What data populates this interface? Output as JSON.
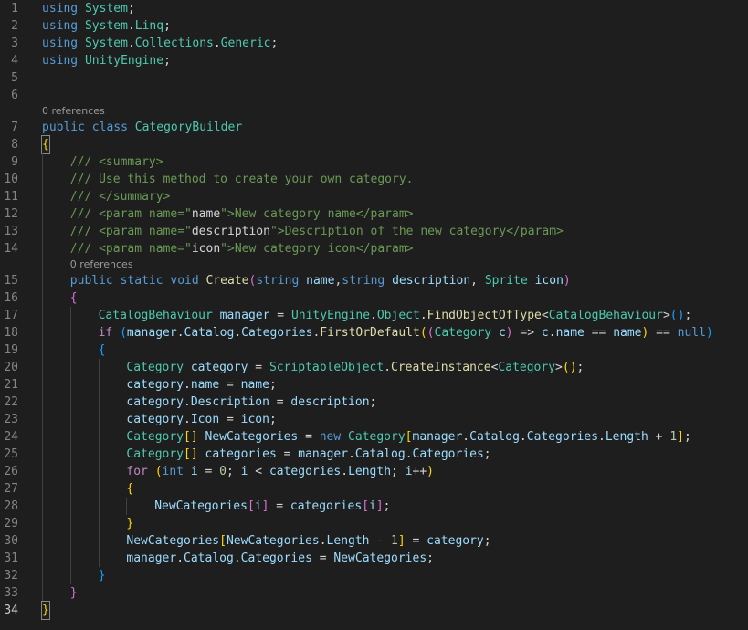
{
  "editor": {
    "theme_colors": {
      "background": "#1e1e1e",
      "keyword": "#569cd6",
      "control": "#c586c0",
      "type": "#4ec9b0",
      "function": "#dcdcaa",
      "identifier": "#9cdcfe",
      "comment": "#6a9955",
      "number": "#b5cea8",
      "bracket_level_1": "#ffd700",
      "bracket_level_2": "#da70d6",
      "bracket_level_3": "#179fff"
    },
    "active_line": 34,
    "lines": [
      {
        "kind": "line",
        "n": "1",
        "tokens": [
          {
            "t": "using",
            "c": "kw"
          },
          {
            "t": " "
          },
          {
            "t": "System",
            "c": "ty"
          },
          {
            "t": ";"
          }
        ]
      },
      {
        "kind": "line",
        "n": "2",
        "tokens": [
          {
            "t": "using",
            "c": "kw"
          },
          {
            "t": " "
          },
          {
            "t": "System",
            "c": "ty"
          },
          {
            "t": "."
          },
          {
            "t": "Linq",
            "c": "ty"
          },
          {
            "t": ";"
          }
        ]
      },
      {
        "kind": "line",
        "n": "3",
        "tokens": [
          {
            "t": "using",
            "c": "kw"
          },
          {
            "t": " "
          },
          {
            "t": "System",
            "c": "ty"
          },
          {
            "t": "."
          },
          {
            "t": "Collections",
            "c": "ty"
          },
          {
            "t": "."
          },
          {
            "t": "Generic",
            "c": "ty"
          },
          {
            "t": ";"
          }
        ]
      },
      {
        "kind": "line",
        "n": "4",
        "tokens": [
          {
            "t": "using",
            "c": "kw"
          },
          {
            "t": " "
          },
          {
            "t": "UnityEngine",
            "c": "ty"
          },
          {
            "t": ";"
          }
        ]
      },
      {
        "kind": "line",
        "n": "5",
        "tokens": []
      },
      {
        "kind": "line",
        "n": "6",
        "tokens": []
      },
      {
        "kind": "lens",
        "indent": 0,
        "text": "0 references"
      },
      {
        "kind": "line",
        "n": "7",
        "tokens": [
          {
            "t": "public",
            "c": "kw"
          },
          {
            "t": " "
          },
          {
            "t": "class",
            "c": "kw"
          },
          {
            "t": " "
          },
          {
            "t": "CategoryBuilder",
            "c": "ty"
          }
        ]
      },
      {
        "kind": "line",
        "n": "8",
        "tokens": [
          {
            "t": "{",
            "c": "b1",
            "cursor": true
          }
        ]
      },
      {
        "kind": "line",
        "n": "9",
        "indent": 1,
        "tokens": [
          {
            "t": "/// ",
            "c": "cm"
          },
          {
            "t": "<summary>",
            "c": "cm"
          }
        ]
      },
      {
        "kind": "line",
        "n": "10",
        "indent": 1,
        "tokens": [
          {
            "t": "/// Use this method to create your own category.",
            "c": "cm"
          }
        ]
      },
      {
        "kind": "line",
        "n": "11",
        "indent": 1,
        "tokens": [
          {
            "t": "/// ",
            "c": "cm"
          },
          {
            "t": "</summary>",
            "c": "cm"
          }
        ]
      },
      {
        "kind": "line",
        "n": "12",
        "indent": 1,
        "tokens": [
          {
            "t": "/// <param name=\"",
            "c": "cm"
          },
          {
            "t": "name",
            "c": "cx"
          },
          {
            "t": "\">New category name</param>",
            "c": "cm"
          }
        ]
      },
      {
        "kind": "line",
        "n": "13",
        "indent": 1,
        "tokens": [
          {
            "t": "/// <param name=\"",
            "c": "cm"
          },
          {
            "t": "description",
            "c": "cx"
          },
          {
            "t": "\">Description of the new category</param>",
            "c": "cm"
          }
        ]
      },
      {
        "kind": "line",
        "n": "14",
        "indent": 1,
        "tokens": [
          {
            "t": "/// <param name=\"",
            "c": "cm"
          },
          {
            "t": "icon",
            "c": "cx"
          },
          {
            "t": "\">New category icon</param>",
            "c": "cm"
          }
        ]
      },
      {
        "kind": "lens",
        "indent": 1,
        "text": "0 references"
      },
      {
        "kind": "line",
        "n": "15",
        "indent": 1,
        "tokens": [
          {
            "t": "public",
            "c": "kw"
          },
          {
            "t": " "
          },
          {
            "t": "static",
            "c": "kw"
          },
          {
            "t": " "
          },
          {
            "t": "void",
            "c": "kw"
          },
          {
            "t": " "
          },
          {
            "t": "Create",
            "c": "fn"
          },
          {
            "t": "(",
            "c": "b2"
          },
          {
            "t": "string",
            "c": "kw"
          },
          {
            "t": " "
          },
          {
            "t": "name",
            "c": "id"
          },
          {
            "t": ","
          },
          {
            "t": "string",
            "c": "kw"
          },
          {
            "t": " "
          },
          {
            "t": "description",
            "c": "id"
          },
          {
            "t": ", "
          },
          {
            "t": "Sprite",
            "c": "ty"
          },
          {
            "t": " "
          },
          {
            "t": "icon",
            "c": "id"
          },
          {
            "t": ")",
            "c": "b2"
          }
        ]
      },
      {
        "kind": "line",
        "n": "16",
        "indent": 1,
        "tokens": [
          {
            "t": "{",
            "c": "b2"
          }
        ]
      },
      {
        "kind": "line",
        "n": "17",
        "indent": 2,
        "tokens": [
          {
            "t": "CatalogBehaviour",
            "c": "ty"
          },
          {
            "t": " "
          },
          {
            "t": "manager",
            "c": "id"
          },
          {
            "t": " = "
          },
          {
            "t": "UnityEngine",
            "c": "ty"
          },
          {
            "t": "."
          },
          {
            "t": "Object",
            "c": "ty"
          },
          {
            "t": "."
          },
          {
            "t": "FindObjectOfType",
            "c": "fn"
          },
          {
            "t": "<"
          },
          {
            "t": "CatalogBehaviour",
            "c": "ty"
          },
          {
            "t": ">"
          },
          {
            "t": "()",
            "c": "b3"
          },
          {
            "t": ";"
          }
        ]
      },
      {
        "kind": "line",
        "n": "18",
        "indent": 2,
        "tokens": [
          {
            "t": "if",
            "c": "ctl"
          },
          {
            "t": " "
          },
          {
            "t": "(",
            "c": "b3"
          },
          {
            "t": "manager",
            "c": "id"
          },
          {
            "t": "."
          },
          {
            "t": "Catalog",
            "c": "id"
          },
          {
            "t": "."
          },
          {
            "t": "Categories",
            "c": "id"
          },
          {
            "t": "."
          },
          {
            "t": "FirstOrDefault",
            "c": "fn"
          },
          {
            "t": "(",
            "c": "b1"
          },
          {
            "t": "(",
            "c": "b2"
          },
          {
            "t": "Category",
            "c": "ty"
          },
          {
            "t": " "
          },
          {
            "t": "c",
            "c": "id"
          },
          {
            "t": ")",
            "c": "b2"
          },
          {
            "t": " => "
          },
          {
            "t": "c",
            "c": "id"
          },
          {
            "t": "."
          },
          {
            "t": "name",
            "c": "id"
          },
          {
            "t": " == "
          },
          {
            "t": "name",
            "c": "id"
          },
          {
            "t": ")",
            "c": "b1"
          },
          {
            "t": " == "
          },
          {
            "t": "null",
            "c": "kw"
          },
          {
            "t": ")",
            "c": "b3"
          }
        ]
      },
      {
        "kind": "line",
        "n": "19",
        "indent": 2,
        "tokens": [
          {
            "t": "{",
            "c": "b3"
          }
        ]
      },
      {
        "kind": "line",
        "n": "20",
        "indent": 3,
        "tokens": [
          {
            "t": "Category",
            "c": "ty"
          },
          {
            "t": " "
          },
          {
            "t": "category",
            "c": "id"
          },
          {
            "t": " = "
          },
          {
            "t": "ScriptableObject",
            "c": "ty"
          },
          {
            "t": "."
          },
          {
            "t": "CreateInstance",
            "c": "fn"
          },
          {
            "t": "<"
          },
          {
            "t": "Category",
            "c": "ty"
          },
          {
            "t": ">"
          },
          {
            "t": "()",
            "c": "b1"
          },
          {
            "t": ";"
          }
        ]
      },
      {
        "kind": "line",
        "n": "21",
        "indent": 3,
        "tokens": [
          {
            "t": "category",
            "c": "id"
          },
          {
            "t": "."
          },
          {
            "t": "name",
            "c": "id"
          },
          {
            "t": " = "
          },
          {
            "t": "name",
            "c": "id"
          },
          {
            "t": ";"
          }
        ]
      },
      {
        "kind": "line",
        "n": "22",
        "indent": 3,
        "tokens": [
          {
            "t": "category",
            "c": "id"
          },
          {
            "t": "."
          },
          {
            "t": "Description",
            "c": "id"
          },
          {
            "t": " = "
          },
          {
            "t": "description",
            "c": "id"
          },
          {
            "t": ";"
          }
        ]
      },
      {
        "kind": "line",
        "n": "23",
        "indent": 3,
        "tokens": [
          {
            "t": "category",
            "c": "id"
          },
          {
            "t": "."
          },
          {
            "t": "Icon",
            "c": "id"
          },
          {
            "t": " = "
          },
          {
            "t": "icon",
            "c": "id"
          },
          {
            "t": ";"
          }
        ]
      },
      {
        "kind": "line",
        "n": "24",
        "indent": 3,
        "tokens": [
          {
            "t": "Category",
            "c": "ty"
          },
          {
            "t": "[]",
            "c": "b1"
          },
          {
            "t": " "
          },
          {
            "t": "NewCategories",
            "c": "id"
          },
          {
            "t": " = "
          },
          {
            "t": "new",
            "c": "kw"
          },
          {
            "t": " "
          },
          {
            "t": "Category",
            "c": "ty"
          },
          {
            "t": "[",
            "c": "b1"
          },
          {
            "t": "manager",
            "c": "id"
          },
          {
            "t": "."
          },
          {
            "t": "Catalog",
            "c": "id"
          },
          {
            "t": "."
          },
          {
            "t": "Categories",
            "c": "id"
          },
          {
            "t": "."
          },
          {
            "t": "Length",
            "c": "id"
          },
          {
            "t": " + "
          },
          {
            "t": "1",
            "c": "num"
          },
          {
            "t": "]",
            "c": "b1"
          },
          {
            "t": ";"
          }
        ]
      },
      {
        "kind": "line",
        "n": "25",
        "indent": 3,
        "tokens": [
          {
            "t": "Category",
            "c": "ty"
          },
          {
            "t": "[]",
            "c": "b1"
          },
          {
            "t": " "
          },
          {
            "t": "categories",
            "c": "id"
          },
          {
            "t": " = "
          },
          {
            "t": "manager",
            "c": "id"
          },
          {
            "t": "."
          },
          {
            "t": "Catalog",
            "c": "id"
          },
          {
            "t": "."
          },
          {
            "t": "Categories",
            "c": "id"
          },
          {
            "t": ";"
          }
        ]
      },
      {
        "kind": "line",
        "n": "26",
        "indent": 3,
        "tokens": [
          {
            "t": "for",
            "c": "ctl"
          },
          {
            "t": " "
          },
          {
            "t": "(",
            "c": "b1"
          },
          {
            "t": "int",
            "c": "kw"
          },
          {
            "t": " "
          },
          {
            "t": "i",
            "c": "id"
          },
          {
            "t": " = "
          },
          {
            "t": "0",
            "c": "num"
          },
          {
            "t": "; "
          },
          {
            "t": "i",
            "c": "id"
          },
          {
            "t": " < "
          },
          {
            "t": "categories",
            "c": "id"
          },
          {
            "t": "."
          },
          {
            "t": "Length",
            "c": "id"
          },
          {
            "t": "; "
          },
          {
            "t": "i",
            "c": "id"
          },
          {
            "t": "++"
          },
          {
            "t": ")",
            "c": "b1"
          }
        ]
      },
      {
        "kind": "line",
        "n": "27",
        "indent": 3,
        "tokens": [
          {
            "t": "{",
            "c": "b1"
          }
        ]
      },
      {
        "kind": "line",
        "n": "28",
        "indent": 4,
        "tokens": [
          {
            "t": "NewCategories",
            "c": "id"
          },
          {
            "t": "[",
            "c": "b2"
          },
          {
            "t": "i",
            "c": "id"
          },
          {
            "t": "]",
            "c": "b2"
          },
          {
            "t": " = "
          },
          {
            "t": "categories",
            "c": "id"
          },
          {
            "t": "[",
            "c": "b2"
          },
          {
            "t": "i",
            "c": "id"
          },
          {
            "t": "]",
            "c": "b2"
          },
          {
            "t": ";"
          }
        ]
      },
      {
        "kind": "line",
        "n": "29",
        "indent": 3,
        "tokens": [
          {
            "t": "}",
            "c": "b1"
          }
        ]
      },
      {
        "kind": "line",
        "n": "30",
        "indent": 3,
        "tokens": [
          {
            "t": "NewCategories",
            "c": "id"
          },
          {
            "t": "[",
            "c": "b1"
          },
          {
            "t": "NewCategories",
            "c": "id"
          },
          {
            "t": "."
          },
          {
            "t": "Length",
            "c": "id"
          },
          {
            "t": " - "
          },
          {
            "t": "1",
            "c": "num"
          },
          {
            "t": "]",
            "c": "b1"
          },
          {
            "t": " = "
          },
          {
            "t": "category",
            "c": "id"
          },
          {
            "t": ";"
          }
        ]
      },
      {
        "kind": "line",
        "n": "31",
        "indent": 3,
        "tokens": [
          {
            "t": "manager",
            "c": "id"
          },
          {
            "t": "."
          },
          {
            "t": "Catalog",
            "c": "id"
          },
          {
            "t": "."
          },
          {
            "t": "Categories",
            "c": "id"
          },
          {
            "t": " = "
          },
          {
            "t": "NewCategories",
            "c": "id"
          },
          {
            "t": ";"
          }
        ]
      },
      {
        "kind": "line",
        "n": "32",
        "indent": 2,
        "tokens": [
          {
            "t": "}",
            "c": "b3"
          }
        ]
      },
      {
        "kind": "line",
        "n": "33",
        "indent": 1,
        "tokens": [
          {
            "t": "}",
            "c": "b2"
          }
        ]
      },
      {
        "kind": "line",
        "n": "34",
        "tokens": [
          {
            "t": "}",
            "c": "b1",
            "cursor": true
          }
        ]
      }
    ]
  }
}
